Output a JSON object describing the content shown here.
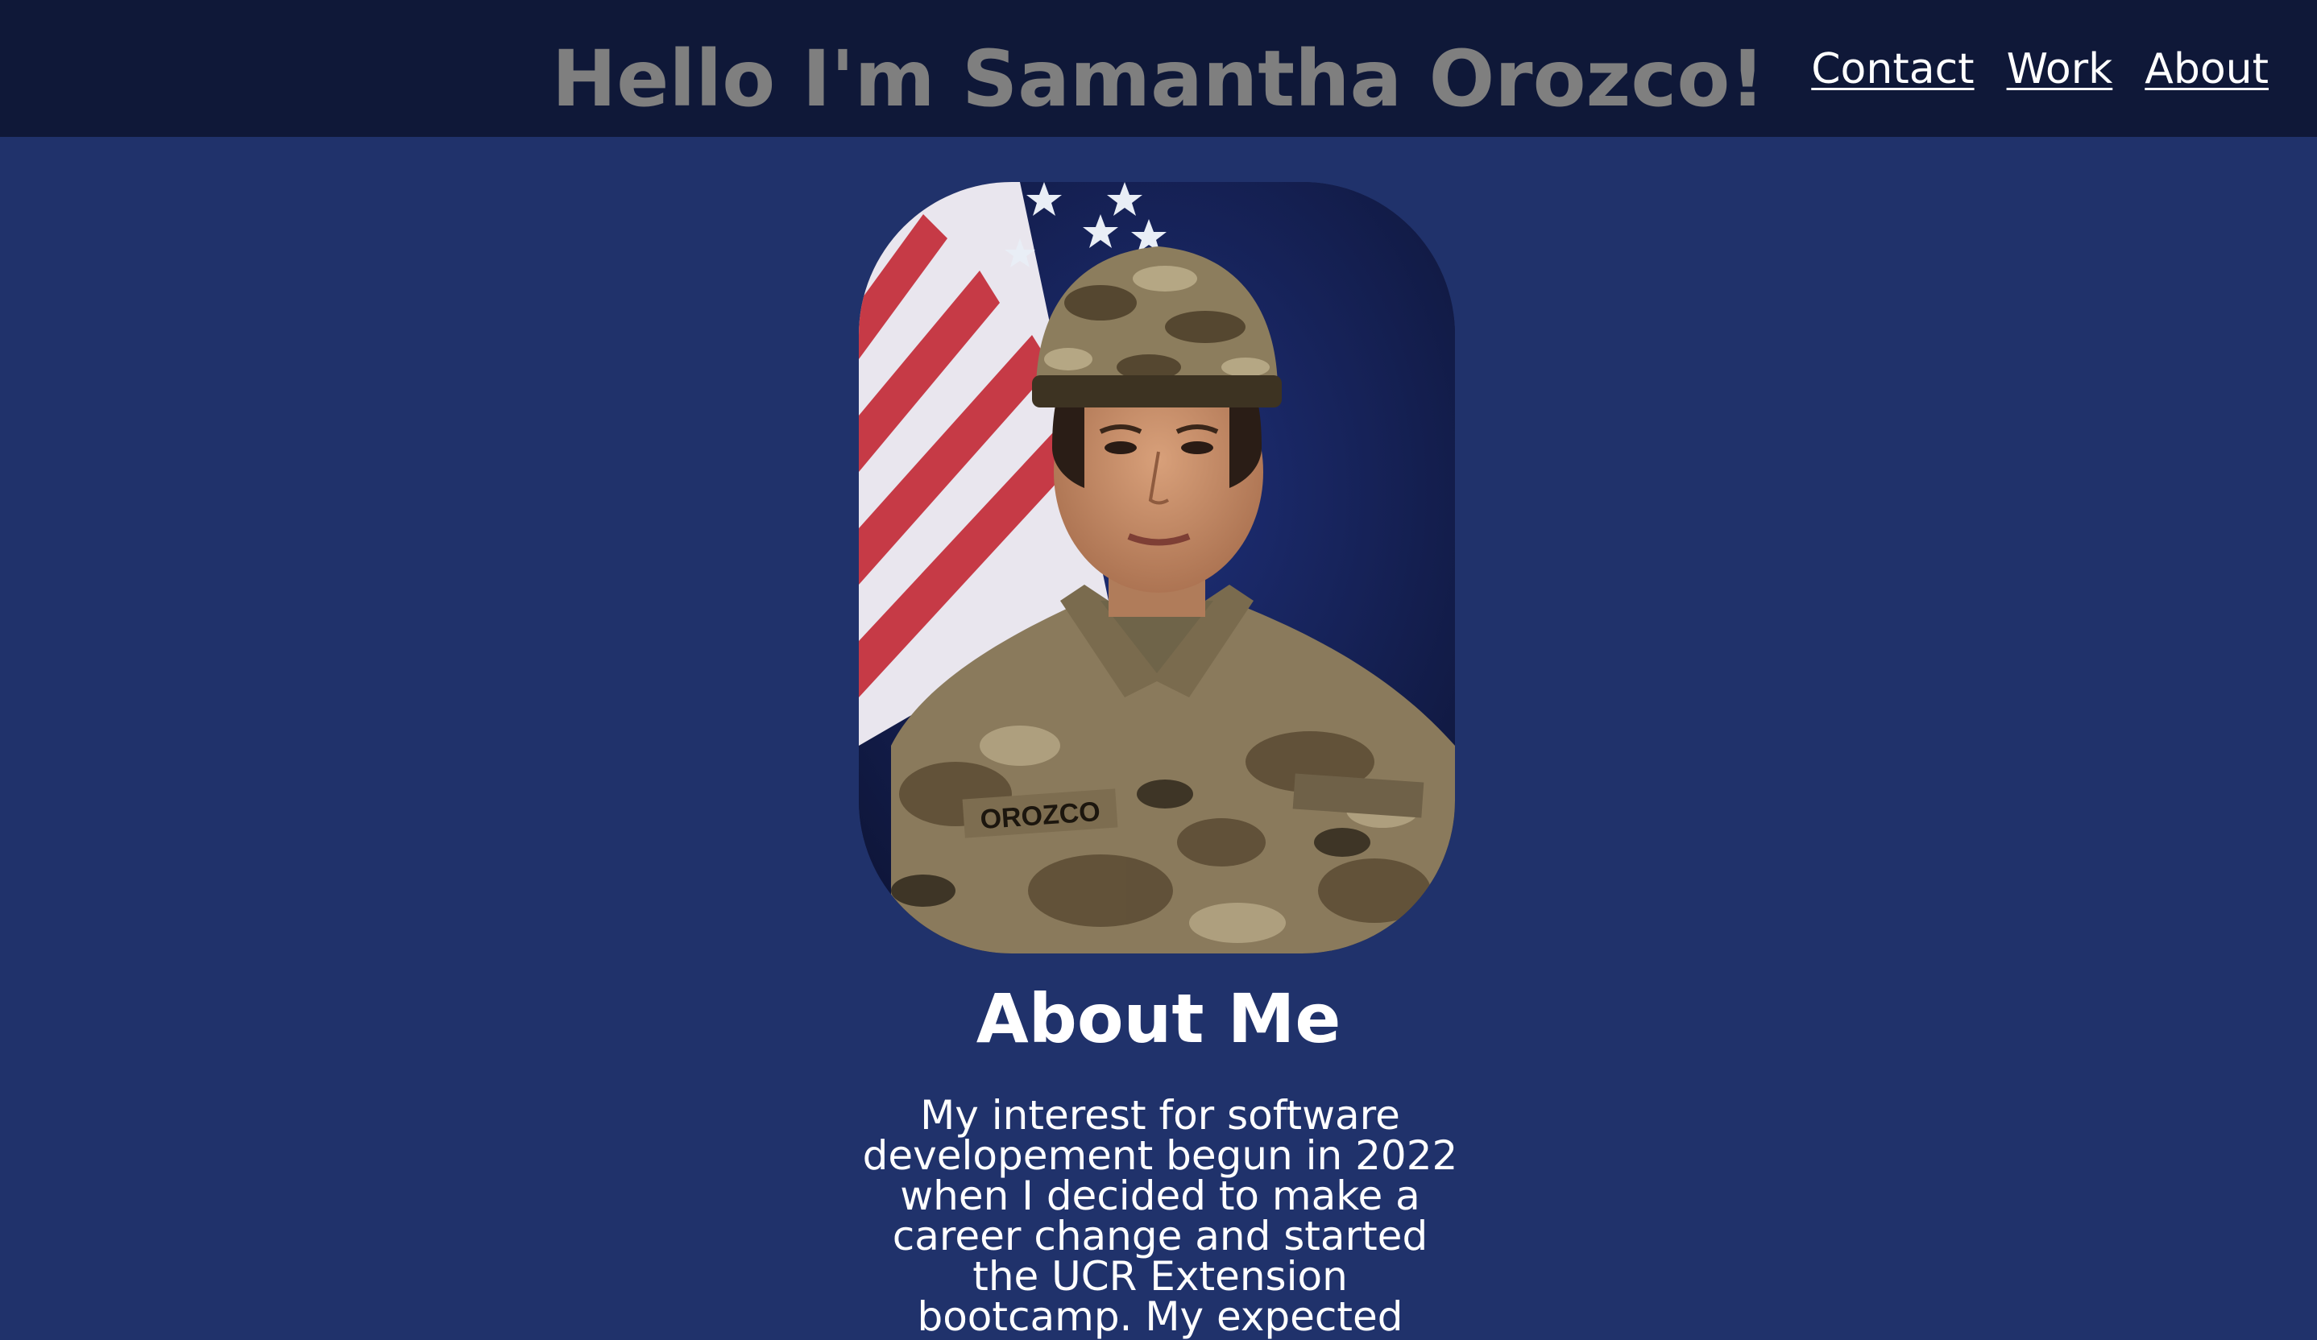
{
  "header": {
    "title": "Hello I'm Samantha Orozco!",
    "nav": [
      {
        "label": "Contact"
      },
      {
        "label": "Work"
      },
      {
        "label": "About"
      }
    ]
  },
  "profile": {
    "image_alt": "Portrait of Samantha Orozco in military uniform in front of an American flag",
    "name_tape": "OROZCO"
  },
  "about": {
    "heading": "About Me",
    "text": "My interest for software developement begun in 2022 when I decided to make a career change and started the UCR Extension bootcamp. My expected"
  },
  "colors": {
    "page_background": "#20326b",
    "header_background": "#0f1838",
    "title_color": "#7f7f7f",
    "text_color": "#ffffff"
  }
}
